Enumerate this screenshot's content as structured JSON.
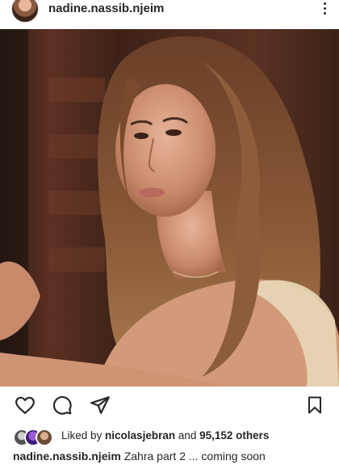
{
  "post": {
    "username": "nadine.nassib.njeim",
    "caption_username": "nadine.nassib.njeim",
    "caption_text": " Zahra part 2 ... coming soon",
    "liked_by_prefix": "Liked by ",
    "liked_by_user": "nicolasjebran",
    "liked_by_mid": " and ",
    "liked_by_count": "95,152 others"
  },
  "icons": {
    "more": "more-vertical-icon",
    "like": "heart-icon",
    "comment": "comment-icon",
    "share": "send-icon",
    "save": "bookmark-icon"
  },
  "colors": {
    "text": "#262626",
    "background": "#ffffff"
  }
}
